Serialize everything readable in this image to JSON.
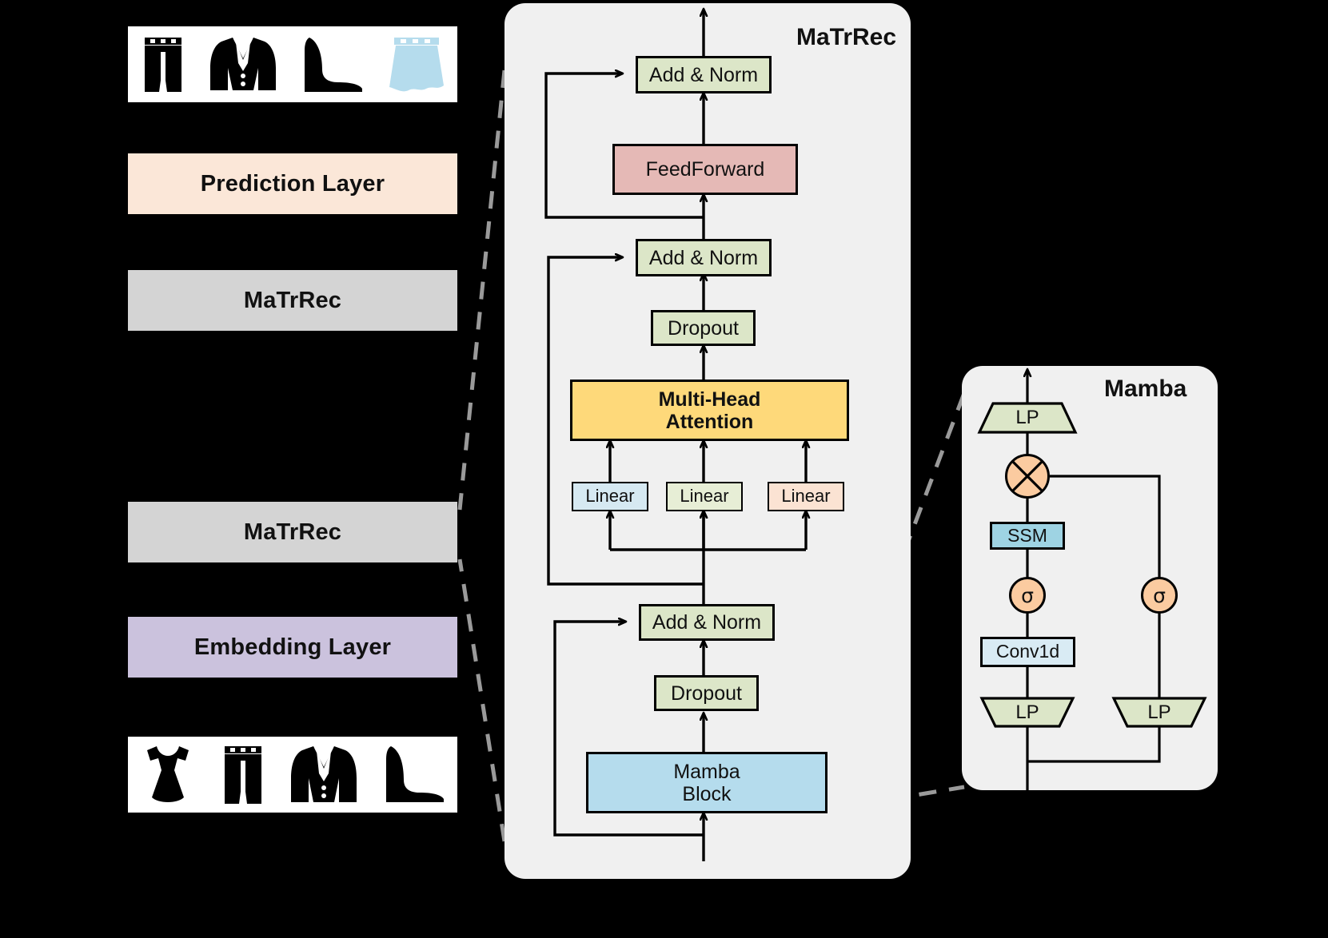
{
  "left_column": {
    "output_items": [
      "pants-icon",
      "blazer-icon",
      "high-heel-icon",
      "skirt-icon"
    ],
    "input_items": [
      "dress-icon",
      "pants-icon",
      "blazer-icon",
      "high-heel-icon"
    ],
    "blocks": [
      {
        "label": "Prediction Layer",
        "color": "#fbe7d8"
      },
      {
        "label": "MaTrRec",
        "color": "#d4d4d4"
      },
      {
        "label": "MaTrRec",
        "color": "#d4d4d4"
      },
      {
        "label": "Embedding Layer",
        "color": "#cbc2dd"
      }
    ]
  },
  "matrrec_panel": {
    "title": "MaTrRec",
    "nodes": {
      "add_norm_top": "Add & Norm",
      "feedforward": "FeedForward",
      "add_norm_mid": "Add & Norm",
      "dropout_mid": "Dropout",
      "attention_l1": "Multi-Head",
      "attention_l2": "Attention",
      "linear_q": "Linear",
      "linear_k": "Linear",
      "linear_v": "Linear",
      "add_norm_bot": "Add & Norm",
      "dropout_bot": "Dropout",
      "mamba_block_l1": "Mamba",
      "mamba_block_l2": "Block"
    },
    "colors": {
      "panel": "#f0f0f0",
      "add_norm": "#dce6c8",
      "feedforward": "#e5b9b6",
      "dropout": "#dce6c8",
      "attention": "#fed97a",
      "linear_q": "#d6e9f2",
      "linear_k": "#e7eed6",
      "linear_v": "#fbe3d3",
      "mamba_block": "#b5dced"
    }
  },
  "mamba_panel": {
    "title": "Mamba",
    "nodes": {
      "lp_top": "LP",
      "multiply": "⊗",
      "ssm": "SSM",
      "sigma_left": "σ",
      "sigma_right": "σ",
      "conv1d": "Conv1d",
      "lp_left": "LP",
      "lp_right": "LP"
    },
    "colors": {
      "panel": "#f0f0f0",
      "lp": "#dce6c8",
      "ssm": "#9ed3e3",
      "conv1d": "#d9ebf4",
      "gate": "#fbcba0"
    }
  },
  "connectors": {
    "style": "dashed",
    "color": "#9a9a9a",
    "note": "dashed guides link left MaTrRec block to centre panel and centre Mamba Block to right Mamba panel"
  }
}
